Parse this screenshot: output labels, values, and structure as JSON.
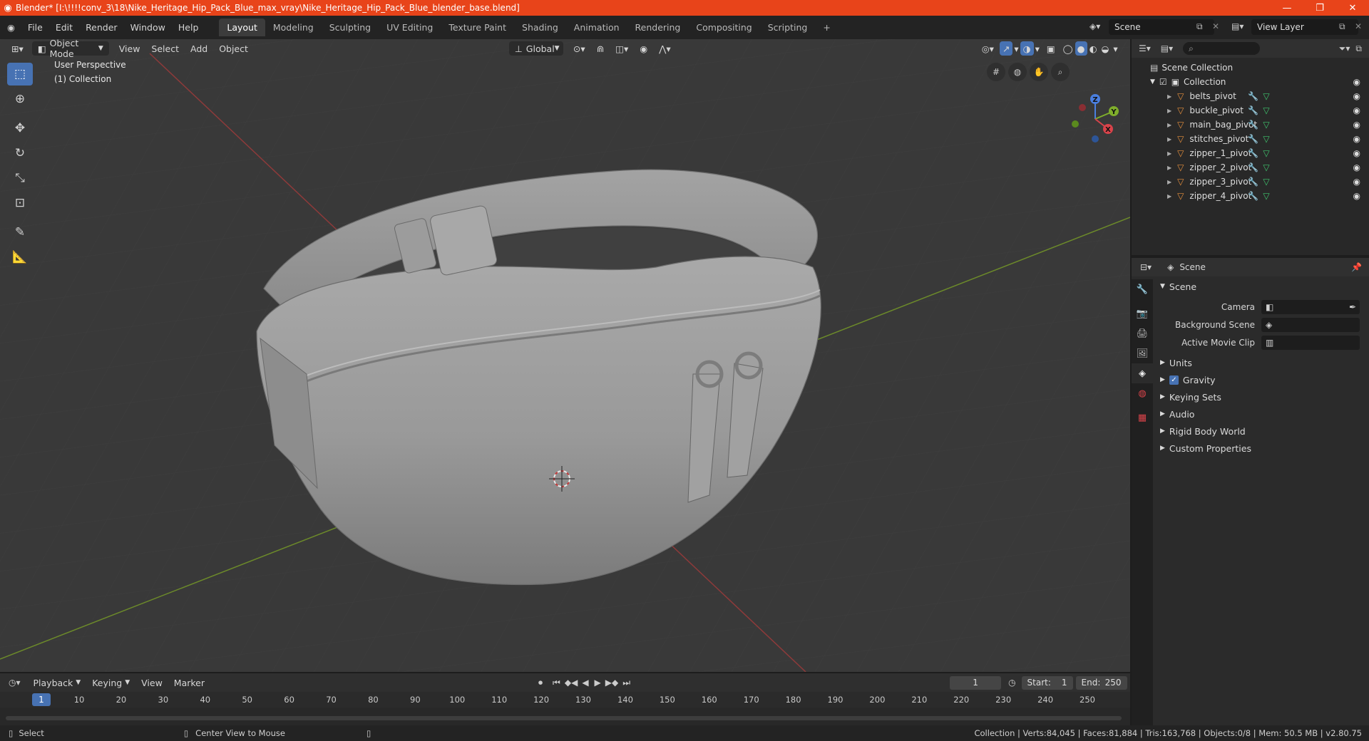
{
  "titlebar": {
    "title": "Blender* [I:\\!!!!conv_3\\18\\Nike_Heritage_Hip_Pack_Blue_max_vray\\Nike_Heritage_Hip_Pack_Blue_blender_base.blend]",
    "minimize": "—",
    "maximize": "❐",
    "close": "✕"
  },
  "menu": {
    "file": "File",
    "edit": "Edit",
    "render": "Render",
    "window": "Window",
    "help": "Help"
  },
  "workspaces": [
    "Layout",
    "Modeling",
    "Sculpting",
    "UV Editing",
    "Texture Paint",
    "Shading",
    "Animation",
    "Rendering",
    "Compositing",
    "Scripting"
  ],
  "active_workspace": "Layout",
  "scene_name": "Scene",
  "view_layer": "View Layer",
  "viewport": {
    "mode": "Object Mode",
    "view": "View",
    "select": "Select",
    "add": "Add",
    "object": "Object",
    "orientation": "Global",
    "perspective_label": "User Perspective",
    "collection_label": "(1) Collection",
    "gizmo": {
      "z": "Z",
      "y": "Y",
      "x": "X"
    }
  },
  "outliner": {
    "root": "Scene Collection",
    "collection": "Collection",
    "items": [
      "belts_pivot",
      "buckle_pivot",
      "main_bag_pivot",
      "stitches_pivot",
      "zipper_1_pivot",
      "zipper_2_pivot",
      "zipper_3_pivot",
      "zipper_4_pivot"
    ]
  },
  "properties": {
    "context": "Scene",
    "panel_title": "Scene",
    "fields": {
      "camera": "Camera",
      "background_scene": "Background Scene",
      "active_movie_clip": "Active Movie Clip"
    },
    "panels": [
      "Units",
      "Gravity",
      "Keying Sets",
      "Audio",
      "Rigid Body World",
      "Custom Properties"
    ],
    "gravity_enabled": true
  },
  "timeline": {
    "playback": "Playback",
    "keying": "Keying",
    "view": "View",
    "marker": "Marker",
    "current_frame": "1",
    "start_label": "Start:",
    "start": "1",
    "end_label": "End:",
    "end": "250",
    "ruler_labels": [
      "10",
      "20",
      "30",
      "40",
      "50",
      "60",
      "70",
      "80",
      "90",
      "100",
      "110",
      "120",
      "130",
      "140",
      "150",
      "160",
      "170",
      "180",
      "190",
      "200",
      "210",
      "220",
      "230",
      "240",
      "250"
    ],
    "ruler_marker": "1"
  },
  "status": {
    "select": "Select",
    "center_view": "Center View to Mouse",
    "stats": "Collection | Verts:84,045 | Faces:81,884 | Tris:163,768 | Objects:0/8 | Mem: 50.5 MB | v2.80.75"
  },
  "colors": {
    "accent": "#4772b3",
    "titlebar": "#e8441a",
    "object_icon": "#e7903d",
    "mesh_icon": "#3fc56e"
  }
}
